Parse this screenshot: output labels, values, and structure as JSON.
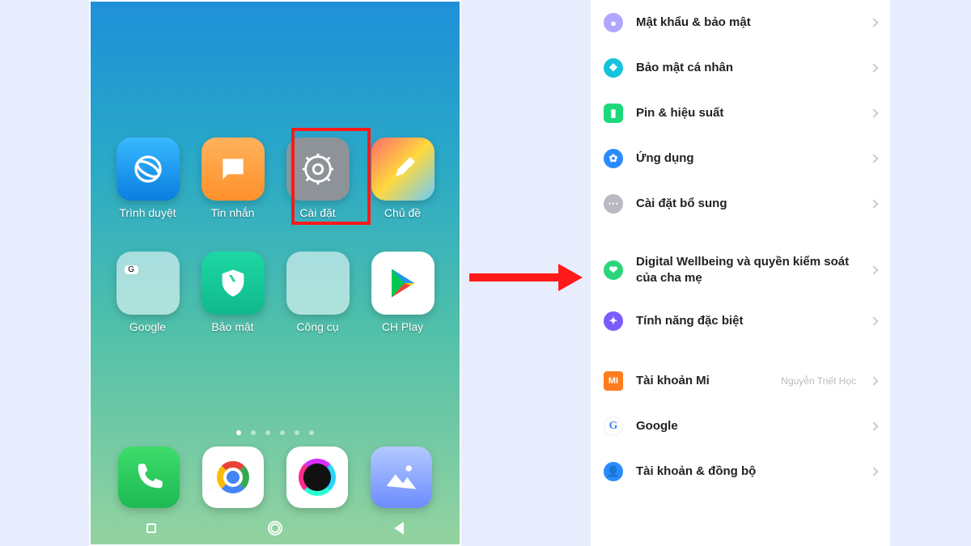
{
  "home": {
    "apps_row1": [
      {
        "label": "Trình duyệt",
        "icon": "browser"
      },
      {
        "label": "Tin nhắn",
        "icon": "message"
      },
      {
        "label": "Cài đặt",
        "icon": "settings",
        "highlighted": true
      },
      {
        "label": "Chủ đề",
        "icon": "theme"
      }
    ],
    "apps_row2": [
      {
        "label": "Google",
        "icon": "google-folder"
      },
      {
        "label": "Bảo mật",
        "icon": "security"
      },
      {
        "label": "Công cụ",
        "icon": "tools-folder"
      },
      {
        "label": "CH Play",
        "icon": "play"
      }
    ],
    "dock": [
      "phone",
      "chrome",
      "camera",
      "gallery"
    ],
    "page_dots": 6,
    "active_dot": 1
  },
  "settings": {
    "items": [
      {
        "icon": "purple",
        "label": "Mật khẩu & bảo mật"
      },
      {
        "icon": "cyan",
        "label": "Bảo mật cá nhân"
      },
      {
        "icon": "green",
        "label": "Pin & hiệu suất"
      },
      {
        "icon": "blue",
        "label": "Ứng dụng"
      },
      {
        "icon": "grey",
        "label": "Cài đặt bổ sung"
      },
      {
        "gap": true
      },
      {
        "icon": "wellbeing",
        "label": "Digital Wellbeing và quyền kiểm soát của cha mẹ"
      },
      {
        "icon": "special",
        "label": "Tính năng đặc biệt"
      },
      {
        "gap": true
      },
      {
        "icon": "mi",
        "label": "Tài khoản Mi",
        "detail": "Nguyễn Triết Học"
      },
      {
        "icon": "google",
        "label": "Google"
      },
      {
        "icon": "account",
        "label": "Tài khoản & đồng bộ"
      }
    ]
  }
}
